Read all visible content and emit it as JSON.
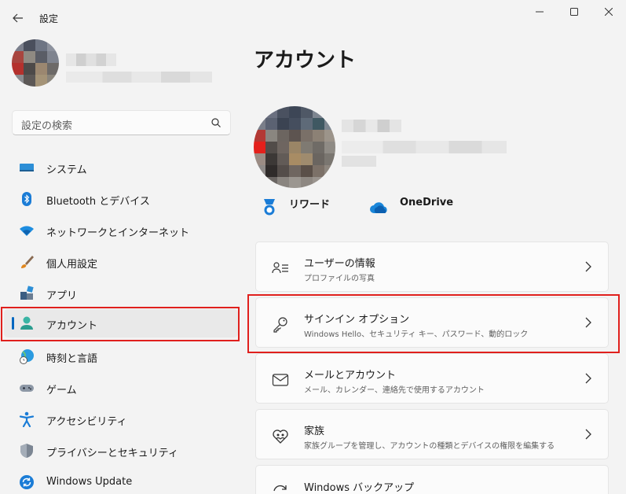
{
  "window": {
    "title": "設定",
    "back_icon": "arrow-left-icon",
    "minimize_icon": "minimize-icon",
    "maximize_icon": "maximize-icon",
    "close_icon": "close-icon"
  },
  "search": {
    "placeholder": "設定の検索",
    "icon": "search-icon"
  },
  "sidebar": {
    "items": [
      {
        "label": "システム",
        "icon": "monitor-icon",
        "active": false
      },
      {
        "label": "Bluetooth とデバイス",
        "icon": "bluetooth-icon",
        "active": false
      },
      {
        "label": "ネットワークとインターネット",
        "icon": "wifi-icon",
        "active": false
      },
      {
        "label": "個人用設定",
        "icon": "paintbrush-icon",
        "active": false
      },
      {
        "label": "アプリ",
        "icon": "apps-icon",
        "active": false
      },
      {
        "label": "アカウント",
        "icon": "person-icon",
        "active": true
      },
      {
        "label": "時刻と言語",
        "icon": "globe-clock-icon",
        "active": false
      },
      {
        "label": "ゲーム",
        "icon": "gamepad-icon",
        "active": false
      },
      {
        "label": "アクセシビリティ",
        "icon": "accessibility-icon",
        "active": false
      },
      {
        "label": "プライバシーとセキュリティ",
        "icon": "shield-icon",
        "active": false
      },
      {
        "label": "Windows Update",
        "icon": "windows-update-icon",
        "active": false
      }
    ]
  },
  "main": {
    "title": "アカウント",
    "badges": [
      {
        "label": "リワード",
        "icon": "rewards-medal-icon"
      },
      {
        "label": "OneDrive",
        "icon": "onedrive-cloud-icon"
      }
    ],
    "cards": [
      {
        "title": "ユーザーの情報",
        "subtitle": "プロファイルの写真",
        "icon": "user-info-icon"
      },
      {
        "title": "サインイン オプション",
        "subtitle": "Windows Hello、セキュリティ キー、パスワード、動的ロック",
        "icon": "key-icon"
      },
      {
        "title": "メールとアカウント",
        "subtitle": "メール、カレンダー、連絡先で使用するアカウント",
        "icon": "mail-icon"
      },
      {
        "title": "家族",
        "subtitle": "家族グループを管理し、アカウントの種類とデバイスの権限を編集する",
        "icon": "family-heart-icon"
      },
      {
        "title": "Windows バックアップ",
        "subtitle": "",
        "icon": "backup-icon"
      }
    ]
  },
  "colors": {
    "accent": "#0067c0",
    "highlight_box": "#e0201d",
    "background": "#f3f3f3",
    "card": "#fbfbfb"
  }
}
